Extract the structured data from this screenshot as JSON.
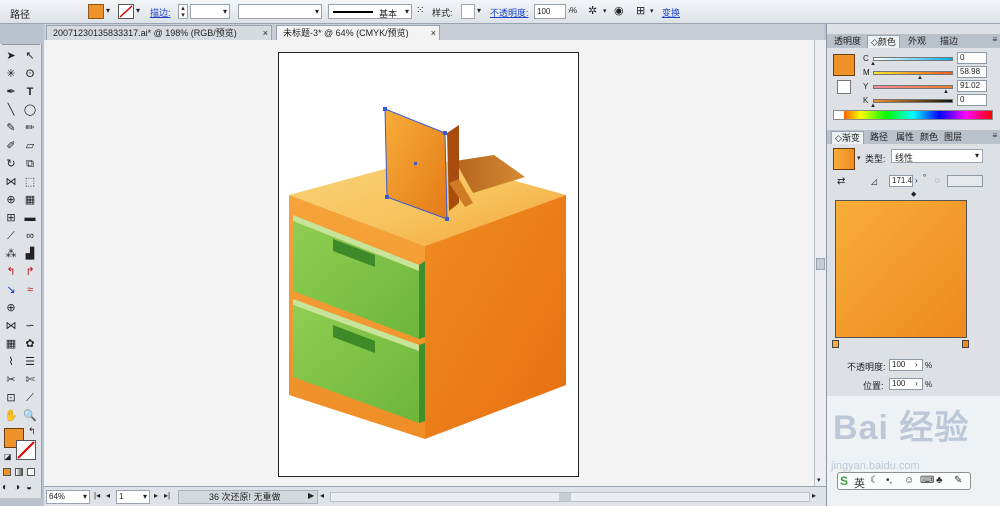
{
  "control_bar": {
    "object_type": "路径",
    "stroke_label": "描边:",
    "stroke_style": "基本",
    "style_label": "样式:",
    "opacity_label": "不透明度:",
    "opacity_value": "100",
    "opacity_unit": "%",
    "transform_link": "变换"
  },
  "tabs": [
    {
      "label": "20071230135833317.ai* @ 198% (RGB/预览)",
      "close": "×",
      "active": false
    },
    {
      "label": "未标题-3* @ 64% (CMYK/预览)",
      "close": "×",
      "active": true
    }
  ],
  "status_bar": {
    "zoom": "64%",
    "page": "1",
    "history": "36 次还原! 无重做"
  },
  "color_panel": {
    "tabs": [
      "透明度",
      "颜色",
      "外观",
      "描边"
    ],
    "channels": [
      {
        "label": "C",
        "value": "0"
      },
      {
        "label": "M",
        "value": "58.98"
      },
      {
        "label": "Y",
        "value": "91.02"
      },
      {
        "label": "K",
        "value": "0"
      }
    ],
    "fill_color": "#f0922a"
  },
  "gradient_panel": {
    "tabs": [
      "渐变",
      "路径",
      "属性",
      "颜色",
      "图层"
    ],
    "type_label": "类型:",
    "type_value": "线性",
    "angle_value": "171.4",
    "angle_unit": "°",
    "opacity_label": "不透明度:",
    "opacity_value": "100",
    "location_label": "位置:",
    "location_value": "100",
    "percent": "%",
    "start_color": "#f7ad3a",
    "end_color": "#ef8a1e"
  },
  "watermark": {
    "logo_text": "Bai 经验",
    "url": "jingyan.baidu.com"
  },
  "ime_bar": {
    "label": "英"
  }
}
